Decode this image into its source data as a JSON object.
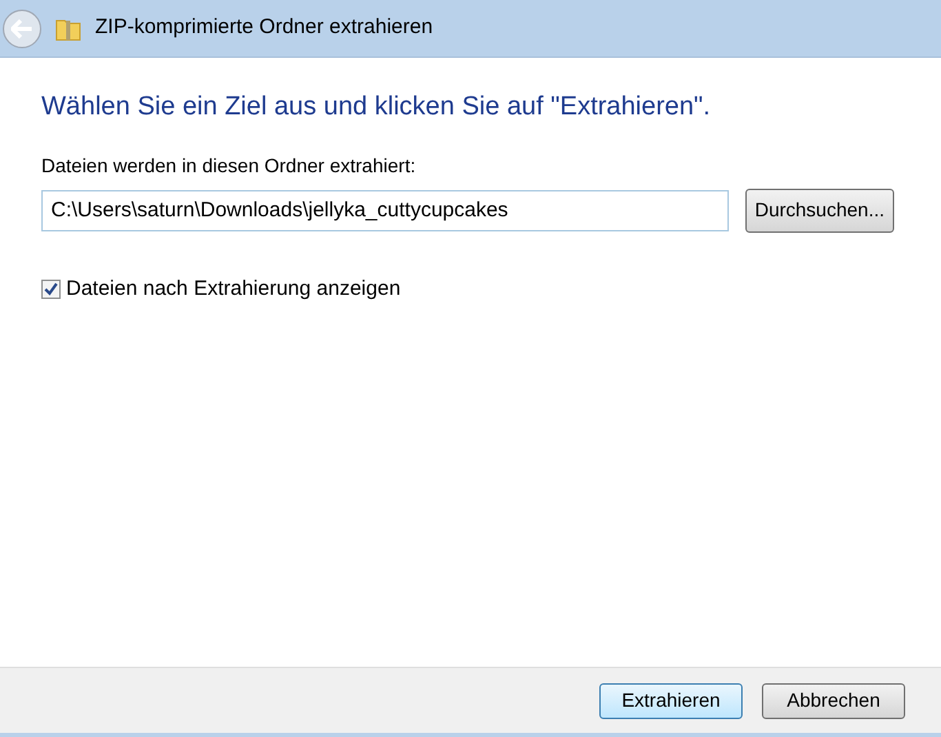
{
  "window": {
    "title": "ZIP-komprimierte Ordner extrahieren"
  },
  "heading": "Wählen Sie ein Ziel aus und klicken Sie auf \"Extrahieren\".",
  "destination": {
    "label": "Dateien werden in diesen Ordner extrahiert:",
    "value": "C:\\Users\\saturn\\Downloads\\jellyka_cuttycupcakes"
  },
  "browse_button": "Durchsuchen...",
  "show_files": {
    "label": "Dateien nach Extrahierung anzeigen",
    "checked": true
  },
  "buttons": [
    {
      "label": "Extrahieren",
      "default": true
    },
    {
      "label": "Abbrechen",
      "default": false
    }
  ]
}
